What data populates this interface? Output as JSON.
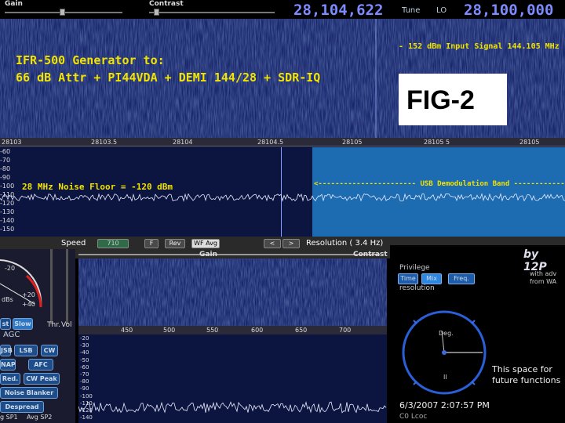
{
  "top_bar": {
    "gain_label": "Gain",
    "contrast_label": "Contrast",
    "tune_freq": "28,104,622",
    "tune_label": "Tune",
    "lo_label": "LO",
    "lo_freq": "28,100,000"
  },
  "annotations": {
    "generator_line1": "IFR-500 Generator to:",
    "generator_line2": "66 dB Attr + PI44VDA + DEMI 144/28 + SDR-IQ",
    "input_signal": "- 152 dBm Input Signal 144.105 MHz",
    "fig_label": "FIG-2",
    "noise_floor": "28 MHz Noise Floor = -120 dBm",
    "usb_band": "<----------------------- USB Demodulation Band ------------------------>"
  },
  "freq_scale": [
    "28103",
    "28103.5",
    "28104",
    "28104.5",
    "28105",
    "28105 5",
    "28105"
  ],
  "dbm_scale": [
    "-60",
    "-70",
    "-80",
    "-90",
    "-100",
    "-110",
    "-120",
    "-130",
    "-140",
    "-150"
  ],
  "controls": {
    "speed_label": "Speed",
    "speed_value": "710",
    "f_btn": "F",
    "rev_btn": "Rev",
    "wfavg_btn": "WF Avg",
    "prev_btn": "<",
    "next_btn": ">",
    "resolution_text": "Resolution  ( 3.4 Hz)",
    "gain_label": "Gain",
    "contrast_label": "Contrast"
  },
  "left_panel": {
    "meter_ticks": [
      "-20",
      "+20",
      "+40"
    ],
    "meter_unit": "dBs",
    "fast_btn": "st",
    "slow_btn": "Slow",
    "thr_label": "Thr.",
    "vol_label": "Vol",
    "agc_label": "AGC",
    "usb_btn": "JSB",
    "lsb_btn": "LSB",
    "cw_btn": "CW",
    "nap_btn": "NAP",
    "afc_btn": "AFC",
    "red_btn": "Red.",
    "cwpeak_btn": "CW Peak",
    "noise_blanker_btn": "Noise Blanker",
    "despread_btn": "Despread",
    "bottom_labels": [
      "g SP1",
      "Avg SP2"
    ]
  },
  "mid_scale": {
    "freq": [
      "450",
      "500",
      "550",
      "600",
      "650",
      "700"
    ],
    "dbm": [
      "-20",
      "-30",
      "-40",
      "-50",
      "-60",
      "-70",
      "-80",
      "-90",
      "-100",
      "-110",
      "-120",
      "-140"
    ]
  },
  "right_panel": {
    "brand": "by 12P",
    "privilege_label": "Privilege",
    "tabs": [
      "Time",
      "Mix",
      "Freq."
    ],
    "resolution_label": "resolution",
    "tagline1": "with adv",
    "tagline2": "from WA",
    "dial_top": "Deg.",
    "dial_bottom": "II",
    "future_text1": "This space for",
    "future_text2": "future functions",
    "timestamp": "6/3/2007  2:07:57 PM",
    "bottom_text": "C0  Lcoc"
  },
  "colors": {
    "freq_display": "#7d8bff",
    "annotation_yellow": "#f2e300",
    "waterfall_bg": "#152263",
    "usb_band": "#1d6bb0",
    "button_blue": "#1e5ba8"
  }
}
